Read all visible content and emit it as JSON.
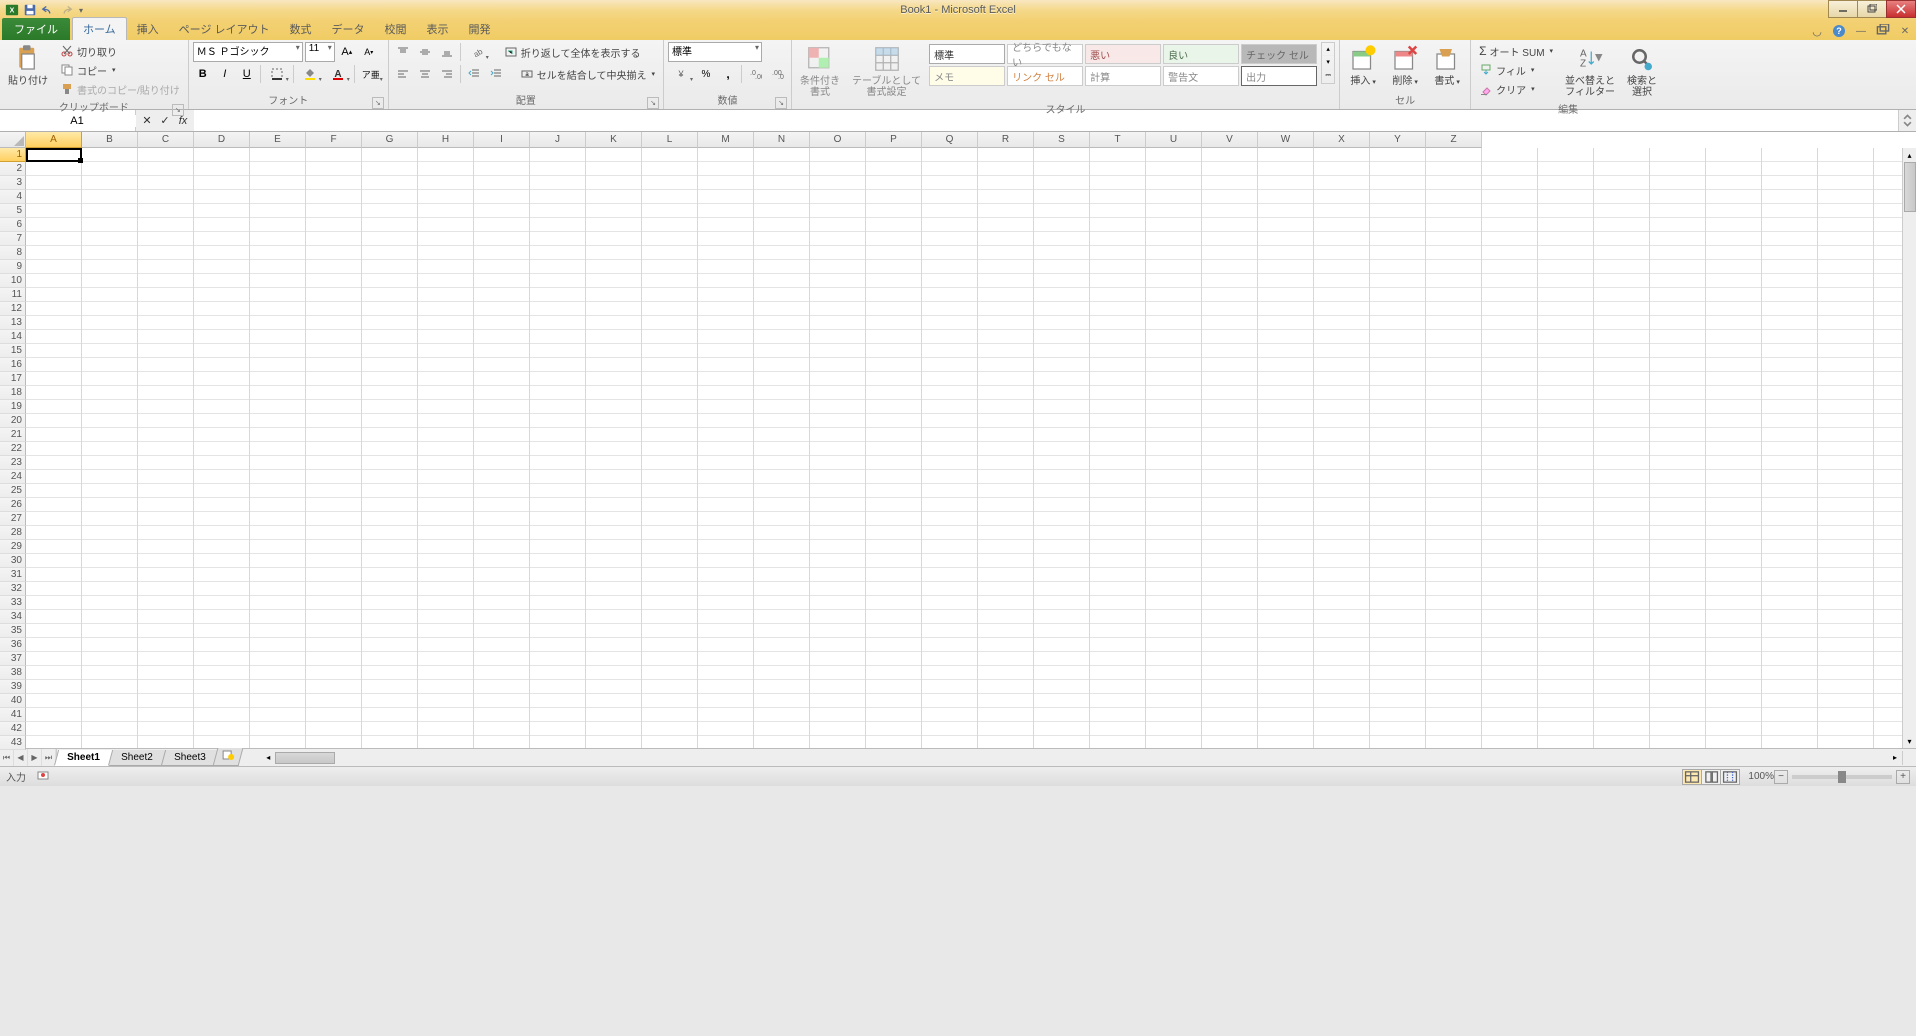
{
  "title": "Book1 - Microsoft Excel",
  "tabs": {
    "file": "ファイル",
    "home": "ホーム",
    "insert": "挿入",
    "page_layout": "ページ レイアウト",
    "formulas": "数式",
    "data": "データ",
    "review": "校閲",
    "view": "表示",
    "developer": "開発"
  },
  "ribbon": {
    "clipboard": {
      "paste": "貼り付け",
      "cut": "切り取り",
      "copy": "コピー",
      "format_painter": "書式のコピー/貼り付け",
      "label": "クリップボード"
    },
    "font": {
      "name": "ＭＳ Ｐゴシック",
      "size": "11",
      "label": "フォント"
    },
    "alignment": {
      "wrap": "折り返して全体を表示する",
      "merge": "セルを結合して中央揃え",
      "label": "配置"
    },
    "number": {
      "format": "標準",
      "label": "数値"
    },
    "styles": {
      "conditional": "条件付き\n書式",
      "table": "テーブルとして\n書式設定",
      "cells": {
        "normal": "標準",
        "neutral": "どちらでもない",
        "bad": "悪い",
        "good": "良い",
        "check": "チェック セル",
        "memo": "メモ",
        "link": "リンク セル",
        "calc": "計算",
        "warning": "警告文",
        "output": "出力"
      },
      "label": "スタイル"
    },
    "cells_grp": {
      "insert": "挿入",
      "delete": "削除",
      "format": "書式",
      "label": "セル"
    },
    "editing": {
      "autosum": "オート SUM",
      "fill": "フィル",
      "clear": "クリア",
      "sort": "並べ替えと\nフィルター",
      "find": "検索と\n選択",
      "label": "編集"
    }
  },
  "namebox": "A1",
  "columns": [
    "A",
    "B",
    "C",
    "D",
    "E",
    "F",
    "G",
    "H",
    "I",
    "J",
    "K",
    "L",
    "M",
    "N",
    "O",
    "P",
    "Q",
    "R",
    "S",
    "T",
    "U",
    "V",
    "W",
    "X",
    "Y",
    "Z"
  ],
  "rows_count": 43,
  "sheets": [
    "Sheet1",
    "Sheet2",
    "Sheet3"
  ],
  "active_sheet": 0,
  "status": {
    "mode": "入力",
    "zoom": "100%"
  }
}
